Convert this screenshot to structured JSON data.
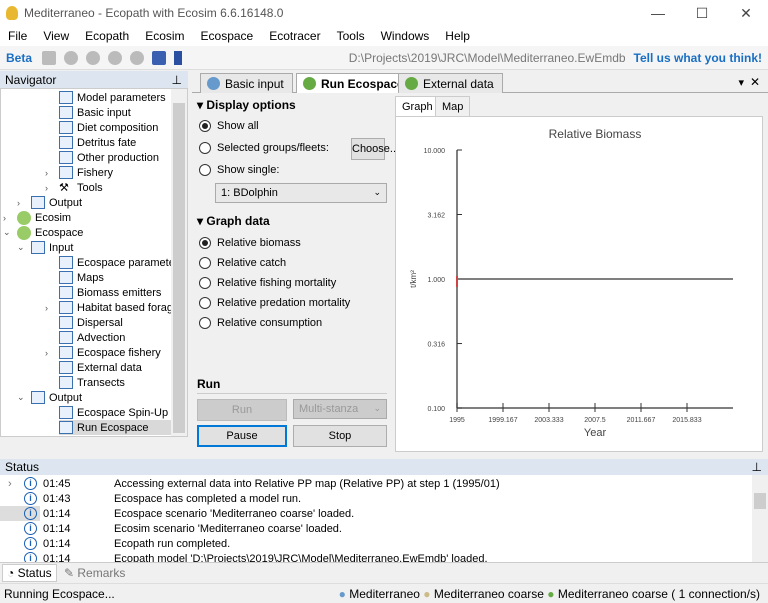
{
  "window": {
    "title": "Mediterraneo - Ecopath with Ecosim 6.6.16148.0",
    "min": "—",
    "max": "☐",
    "close": "✕"
  },
  "menu": [
    "File",
    "View",
    "Ecopath",
    "Ecosim",
    "Ecospace",
    "Ecotracer",
    "Tools",
    "Windows",
    "Help"
  ],
  "toolbar": {
    "beta": "Beta",
    "path": "D:\\Projects\\2019\\JRC\\Model\\Mediterraneo.EwEmdb",
    "feedback": "Tell us what you think!"
  },
  "navigator": {
    "title": "Navigator",
    "pin": "⊥",
    "items": [
      {
        "label": "Model parameters",
        "indent": 4,
        "icon": "form"
      },
      {
        "label": "Basic input",
        "indent": 4,
        "icon": "form"
      },
      {
        "label": "Diet composition",
        "indent": 4,
        "icon": "form"
      },
      {
        "label": "Detritus fate",
        "indent": 4,
        "icon": "form"
      },
      {
        "label": "Other production",
        "indent": 4,
        "icon": "form"
      },
      {
        "label": "Fishery",
        "indent": 4,
        "icon": "form",
        "arrow": "›"
      },
      {
        "label": "Tools",
        "indent": 4,
        "icon": "tools",
        "arrow": "›"
      },
      {
        "label": "Output",
        "indent": 2,
        "icon": "form",
        "arrow": "›"
      },
      {
        "label": "Ecosim",
        "indent": 1,
        "icon": "globe",
        "arrow": "›"
      },
      {
        "label": "Ecospace",
        "indent": 1,
        "icon": "globe",
        "arrow": "⌄"
      },
      {
        "label": "Input",
        "indent": 2,
        "icon": "form",
        "arrow": "⌄"
      },
      {
        "label": "Ecospace parameter",
        "indent": 4,
        "icon": "form"
      },
      {
        "label": "Maps",
        "indent": 4,
        "icon": "form"
      },
      {
        "label": "Biomass emitters",
        "indent": 4,
        "icon": "form"
      },
      {
        "label": "Habitat based foragin",
        "indent": 4,
        "icon": "form",
        "arrow": "›"
      },
      {
        "label": "Dispersal",
        "indent": 4,
        "icon": "form"
      },
      {
        "label": "Advection",
        "indent": 4,
        "icon": "form"
      },
      {
        "label": "Ecospace fishery",
        "indent": 4,
        "icon": "form",
        "arrow": "›"
      },
      {
        "label": "External data",
        "indent": 4,
        "icon": "form"
      },
      {
        "label": "Transects",
        "indent": 4,
        "icon": "form"
      },
      {
        "label": "Output",
        "indent": 2,
        "icon": "form",
        "arrow": "⌄"
      },
      {
        "label": "Ecospace Spin-Up",
        "indent": 4,
        "icon": "form"
      },
      {
        "label": "Run Ecospace",
        "indent": 4,
        "icon": "form",
        "selected": true
      }
    ]
  },
  "doc_tabs": {
    "tabs": [
      "Basic input",
      "Run Ecospace",
      "External data"
    ],
    "active": 1,
    "menu": "▾",
    "close": "✕"
  },
  "options": {
    "display_title": "Display options",
    "show_all": "Show all",
    "selected_groups": "Selected groups/fleets:",
    "choose": "Choose...",
    "show_single": "Show single:",
    "single_value": "1: BDolphin",
    "graph_title": "Graph data",
    "graph_options": [
      "Relative biomass",
      "Relative catch",
      "Relative fishing mortality",
      "Relative predation mortality",
      "Relative consumption"
    ],
    "run_title": "Run",
    "run": "Run",
    "stanza": "Multi-stanza",
    "pause": "Pause",
    "stop": "Stop"
  },
  "graph_tabs": [
    "Graph",
    "Map"
  ],
  "chart_data": {
    "type": "line",
    "title": "Relative Biomass",
    "xlabel": "Year",
    "ylabel": "t/km²",
    "yscale": "log",
    "ylim": [
      0.1,
      10
    ],
    "xlim": [
      1995,
      2020
    ],
    "yticks": [
      "10.000",
      "3.162",
      "1.000",
      "0.316",
      "0.100"
    ],
    "ytick_values": [
      10,
      3.162,
      1,
      0.316,
      0.1
    ],
    "xticks": [
      "1995",
      "1999.167",
      "2003.333",
      "2007.5",
      "2011.667",
      "2015.833"
    ],
    "xtick_values": [
      1995,
      1999.167,
      2003.333,
      2007.5,
      2011.667,
      2015.833
    ],
    "series": [
      {
        "name": "Relative biomass",
        "x": [
          1995,
          2020
        ],
        "y": [
          1,
          1
        ],
        "color": "#333333"
      }
    ]
  },
  "status": {
    "title": "Status",
    "rows": [
      {
        "time": "01:45",
        "msg": "Accessing external data into Relative PP map (Relative PP) at step 1 (1995/01)"
      },
      {
        "time": "01:43",
        "msg": "Ecospace has completed a model run."
      },
      {
        "time": "01:14",
        "msg": "Ecospace scenario 'Mediterraneo coarse' loaded."
      },
      {
        "time": "01:14",
        "msg": "Ecosim scenario 'Mediterraneo coarse' loaded."
      },
      {
        "time": "01:14",
        "msg": "Ecopath run completed."
      },
      {
        "time": "01:14",
        "msg": "Ecopath model 'D:\\Projects\\2019\\JRC\\Model\\Mediterraneo.EwEmdb' loaded."
      }
    ]
  },
  "bottom_tabs": [
    "Status",
    "Remarks"
  ],
  "statusbar": {
    "text": "Running Ecospace...",
    "model": "Mediterraneo",
    "ecosim": "Mediterraneo coarse",
    "ecospace": "Mediterraneo coarse ( 1 connection/s)"
  }
}
